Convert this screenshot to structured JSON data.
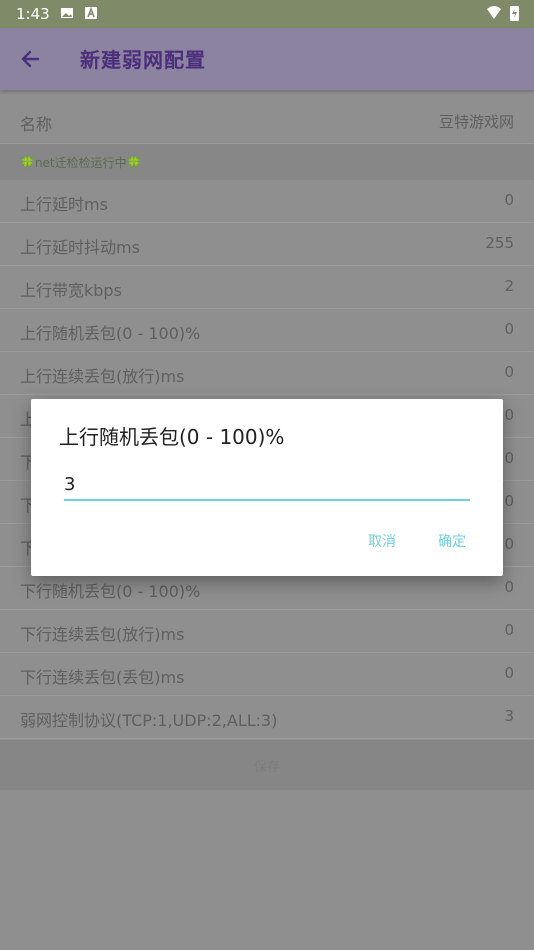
{
  "status_bar": {
    "time": "1:43"
  },
  "app_bar": {
    "title": "新建弱网配置"
  },
  "list": {
    "name_row": {
      "label": "名称",
      "value": "豆特游戏网"
    },
    "section_header": "🍀net迁检检运行中🍀",
    "rows": [
      {
        "label": "上行延时ms",
        "value": "0"
      },
      {
        "label": "上行延时抖动ms",
        "value": "255"
      },
      {
        "label": "上行带宽kbps",
        "value": "2"
      },
      {
        "label": "上行随机丢包(0 - 100)%",
        "value": "0"
      },
      {
        "label": "上行连续丢包(放行)ms",
        "value": "0"
      },
      {
        "label": "上",
        "value": "0"
      },
      {
        "label": "下",
        "value": "0"
      },
      {
        "label": "下",
        "value": "0"
      },
      {
        "label": "下",
        "value": "0"
      },
      {
        "label": "下行随机丢包(0 - 100)%",
        "value": "0"
      },
      {
        "label": "下行连续丢包(放行)ms",
        "value": "0"
      },
      {
        "label": "下行连续丢包(丢包)ms",
        "value": "0"
      },
      {
        "label": "弱网控制协议(TCP:1,UDP:2,ALL:3)",
        "value": "3"
      }
    ]
  },
  "bottom_button": {
    "label": "保存"
  },
  "dialog": {
    "title": "上行随机丢包(0 - 100)%",
    "input_value": "3",
    "cancel_label": "取消",
    "ok_label": "确定"
  },
  "colors": {
    "accent": "#6fd0e0",
    "app_bar_title": "#4b2f7c"
  }
}
